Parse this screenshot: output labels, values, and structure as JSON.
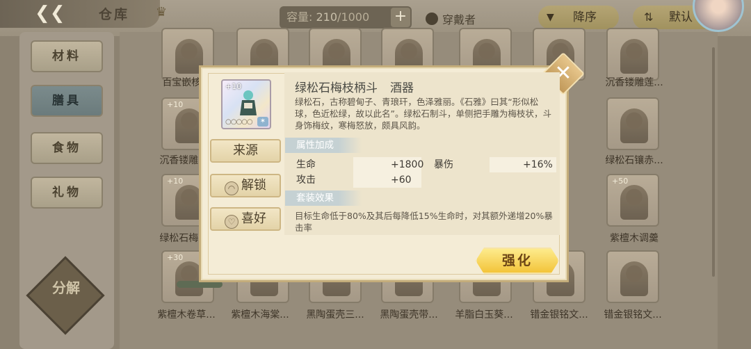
{
  "header": {
    "back_icon": "chevron-left-icon",
    "title": "仓库",
    "capacity_label": "容量:",
    "capacity_used": "210",
    "capacity_total": "/1000",
    "wearer_label": "穿戴者",
    "sort_label": "降序",
    "default_label": "默认"
  },
  "sidebar": {
    "tabs": [
      {
        "label": "材料",
        "active": false
      },
      {
        "label": "膳具",
        "active": true
      },
      {
        "label": "食物",
        "active": false
      },
      {
        "label": "礼物",
        "active": false
      }
    ],
    "decompose_label": "分解"
  },
  "grid": {
    "row1_labels": [
      "百宝嵌核...",
      "",
      "",
      "",
      "",
      "沉香镂雕莲..."
    ],
    "row2_labels": [
      "沉香镂雕...",
      "绿松石镶赤..."
    ],
    "row3_labels": [
      "绿松石梅...",
      "紫檀木调羹"
    ],
    "row4_labels": [
      "紫檀木卷草...",
      "紫檀木海棠...",
      "黑陶蛋壳三...",
      "黑陶蛋壳带...",
      "羊脂白玉葵...",
      "错金银铭文...",
      "错金银铭文..."
    ],
    "level_tags": [
      "+10",
      "+10",
      "+50",
      "+30"
    ]
  },
  "dialog": {
    "icon_level": "+10",
    "item_name": "绿松石梅枝柄斗",
    "item_type": "酒器",
    "description": "绿松石，古称碧甸子、青琅玕，色泽雅丽。《石雅》曰其“形似松球，色近松绿，故以此名”。绿松石制斗，单侧把手雕为梅枝状，斗身饰梅纹，寒梅怒放，颇具风韵。",
    "attr_header": "属性加成",
    "stats": {
      "hp_name": "生命",
      "hp_value": "+1800",
      "crit_name": "暴伤",
      "crit_value": "+16%",
      "atk_name": "攻击",
      "atk_value": "+60"
    },
    "set_header": "套装效果",
    "set_effect": "目标生命低于80%及其后每降低15%生命时，对其额外递增20%暴击率",
    "buttons": {
      "source": "来源",
      "unlock": "解锁",
      "favor": "喜好",
      "enhance": "强化"
    }
  }
}
